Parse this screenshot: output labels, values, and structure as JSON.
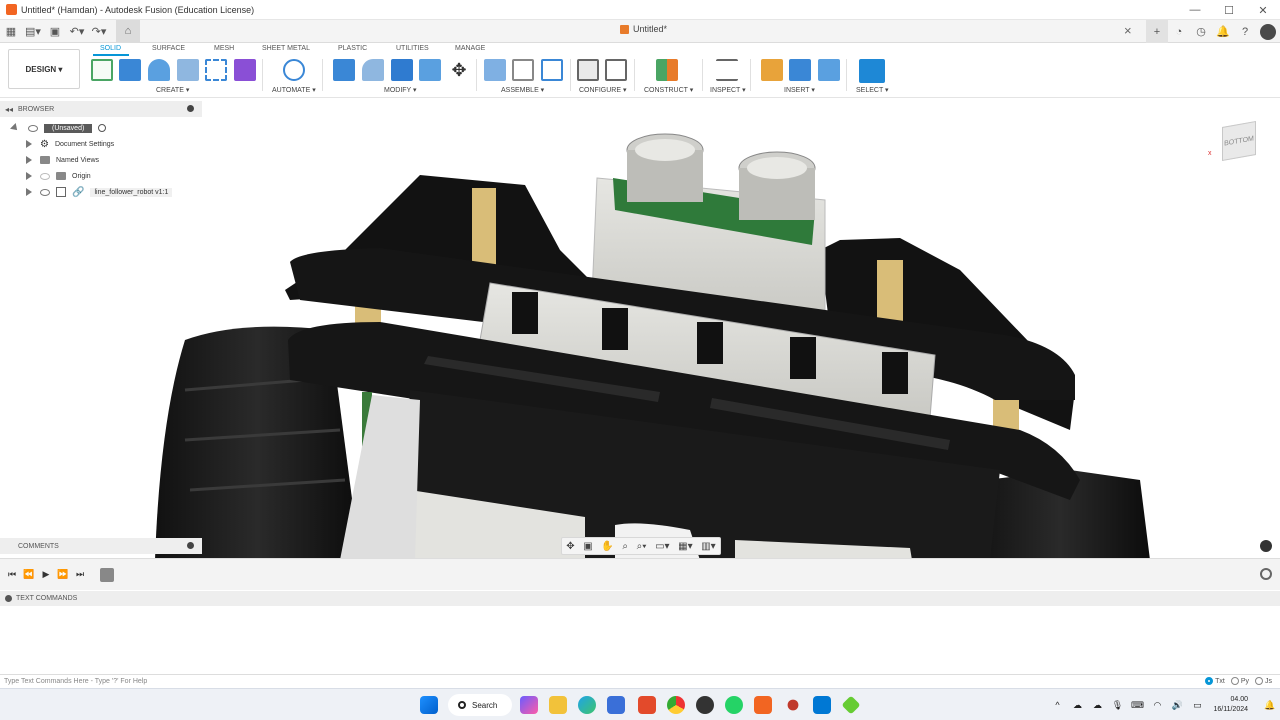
{
  "window": {
    "title": "Untitled* (Hamdan) - Autodesk Fusion (Education License)",
    "controls": [
      "—",
      "☐",
      "✕"
    ]
  },
  "document_tab": {
    "name": "Untitled*"
  },
  "ribbon": {
    "workspace": "DESIGN ▾",
    "tabs": [
      "SOLID",
      "SURFACE",
      "MESH",
      "SHEET METAL",
      "PLASTIC",
      "UTILITIES",
      "MANAGE"
    ],
    "groups": [
      "CREATE ▾",
      "AUTOMATE ▾",
      "MODIFY ▾",
      "ASSEMBLE ▾",
      "CONFIGURE ▾",
      "CONSTRUCT ▾",
      "INSPECT ▾",
      "INSERT ▾",
      "SELECT ▾"
    ]
  },
  "browser": {
    "header": "BROWSER",
    "root": "(Unsaved)",
    "items": [
      "Document Settings",
      "Named Views",
      "Origin",
      "line_follower_robot v1:1"
    ]
  },
  "viewcube": {
    "face": "BOTTOM"
  },
  "comments": {
    "header": "COMMENTS"
  },
  "text_commands": {
    "header": "TEXT COMMANDS",
    "placeholder": "Type Text Commands Here - Type '?' For Help",
    "modes": [
      "Txt",
      "Py",
      "Js"
    ]
  },
  "taskbar": {
    "search": "Search",
    "time": "04.00",
    "date": "16/11/2024"
  },
  "colors": {
    "accent": "#0696d7",
    "fusion_orange": "#f26522"
  }
}
